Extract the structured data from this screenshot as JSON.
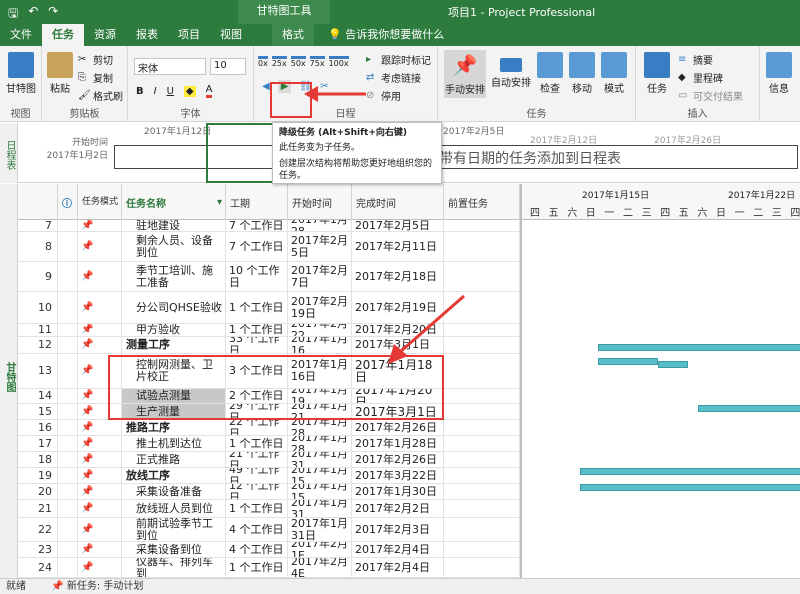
{
  "app": {
    "window_title": "项目1 - Project Professional",
    "context_tool": "甘特图工具"
  },
  "tabs": [
    "文件",
    "任务",
    "资源",
    "报表",
    "项目",
    "视图"
  ],
  "format_tab": "格式",
  "tellme": "告诉我你想要做什么",
  "ribbon": {
    "view_group": {
      "gantt": "甘特图",
      "label": "视图"
    },
    "clipboard": {
      "paste": "粘贴",
      "cut": "剪切",
      "copy": "复制",
      "format_painter": "格式刷",
      "label": "剪贴板"
    },
    "font": {
      "name": "宋体",
      "size": "10",
      "label": "字体"
    },
    "schedule": {
      "track": "跟踪时标记",
      "link": "考虑链接",
      "inactive": "停用",
      "label": "日程",
      "pcts": [
        "0x",
        "25x",
        "50x",
        "75x",
        "100x"
      ]
    },
    "tasks": {
      "manual": "手动安排",
      "auto": "自动安排",
      "inspect": "检查",
      "move": "移动",
      "mode": "模式",
      "label": "任务"
    },
    "insert": {
      "task": "任务",
      "summary": "摘要",
      "milestone": "里程碑",
      "deliverable": "可交付结果",
      "label": "插入"
    },
    "info": "信息"
  },
  "timeline": {
    "side": "日程表",
    "start_label": "开始时间",
    "start_date": "2017年1月2日",
    "dates": [
      "2017年1月12日",
      "2017年2月5日",
      "2017年2月12日",
      "2017年2月26日"
    ],
    "placeholder": "将带有日期的任务添加到日程表"
  },
  "tooltip": {
    "title": "降级任务 (Alt+Shift+向右键)",
    "line1": "此任务变为子任务。",
    "line2": "创建层次结构将帮助您更好地组织您的任务。"
  },
  "grid": {
    "side": "甘特图",
    "headers": {
      "info": "ⓘ",
      "mode": "任务模式",
      "name": "任务名称",
      "duration": "工期",
      "start": "开始时间",
      "finish": "完成时间",
      "pred": "前置任务"
    },
    "rows": [
      {
        "id": "7",
        "name": "驻地建设",
        "dur": "7 个工作日",
        "start": "2017年1月28",
        "finish": "2017年2月5日"
      },
      {
        "id": "8",
        "name": "剩余人员、设备到位",
        "dur": "7 个工作日",
        "start": "2017年2月5日",
        "finish": "2017年2月11日"
      },
      {
        "id": "9",
        "name": "季节工培训、施工准备",
        "dur": "10 个工作日",
        "start": "2017年2月7日",
        "finish": "2017年2月18日"
      },
      {
        "id": "10",
        "name": "分公司QHSE验收",
        "dur": "1 个工作日",
        "start": "2017年2月19日",
        "finish": "2017年2月19日"
      },
      {
        "id": "11",
        "name": "甲方验收",
        "dur": "1 个工作日",
        "start": "2017年2月22",
        "finish": "2017年2月20日"
      },
      {
        "id": "12",
        "name": "测量工序",
        "dur": "33 个工作日",
        "start": "2017年1月16",
        "finish": "2017年3月1日"
      },
      {
        "id": "13",
        "name": "控制网测量、卫片校正",
        "dur": "3 个工作日",
        "start": "2017年1月16日",
        "finish": "2017年1月18日"
      },
      {
        "id": "14",
        "name": "试验点测量",
        "dur": "2 个工作日",
        "start": "2017年1月19",
        "finish": "2017年1月20日"
      },
      {
        "id": "15",
        "name": "生产测量",
        "dur": "29 个工作日",
        "start": "2017年1月21",
        "finish": "2017年3月1日"
      },
      {
        "id": "16",
        "name": "推路工序",
        "dur": "22 个工作日",
        "start": "2017年1月28",
        "finish": "2017年2月26日"
      },
      {
        "id": "17",
        "name": "推土机到达位",
        "dur": "1 个工作日",
        "start": "2017年1月28",
        "finish": "2017年1月28日"
      },
      {
        "id": "18",
        "name": "正式推路",
        "dur": "21 个工作日",
        "start": "2017年1月31",
        "finish": "2017年2月26日"
      },
      {
        "id": "19",
        "name": "放线工序",
        "dur": "49 个工作日",
        "start": "2017年1月15",
        "finish": "2017年3月22日"
      },
      {
        "id": "20",
        "name": "采集设备准备",
        "dur": "12 个工作日",
        "start": "2017年1月15",
        "finish": "2017年1月30日"
      },
      {
        "id": "21",
        "name": "放线班人员到位",
        "dur": "1 个工作日",
        "start": "2017年1月31",
        "finish": "2017年2月2日"
      },
      {
        "id": "22",
        "name": "前期试验季节工到位",
        "dur": "4 个工作日",
        "start": "2017年1月31日",
        "finish": "2017年2月3日"
      },
      {
        "id": "23",
        "name": "采集设备到位",
        "dur": "4 个工作日",
        "start": "2017年2月1E",
        "finish": "2017年2月4日"
      },
      {
        "id": "24",
        "name": "仪器车、排列车到",
        "dur": "1 个工作日",
        "start": "2017年2月4E",
        "finish": "2017年2月4日"
      }
    ]
  },
  "gantt": {
    "weeks": [
      "2017年1月15日",
      "2017年1月22日"
    ],
    "days": [
      "四",
      "五",
      "六",
      "日",
      "一",
      "二",
      "三",
      "四",
      "五",
      "六",
      "日",
      "一",
      "二",
      "三",
      "四"
    ]
  },
  "status": {
    "ready": "就绪",
    "new_task": "新任务: 手动计划"
  }
}
